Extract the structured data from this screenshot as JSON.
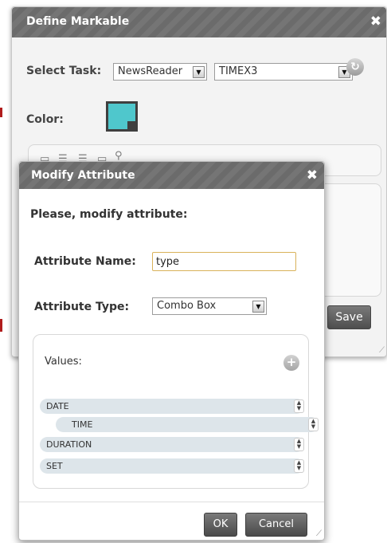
{
  "background_dialog": {
    "title": "Define Markable",
    "close_glyph": "✖",
    "select_task_label": "Select Task:",
    "task_select_value": "NewsReader",
    "markable_select_value": "TIMEX3",
    "color_label": "Color:",
    "save_label": "Save",
    "accent_color": "#4fc7cc",
    "icons": [
      "refresh-icon",
      "list-icon",
      "list-icon",
      "list-icon",
      "box-icon",
      "tag-icon"
    ]
  },
  "modify_dialog": {
    "title": "Modify Attribute",
    "close_glyph": "✖",
    "prompt": "Please, modify attribute:",
    "attribute_name_label": "Attribute Name:",
    "attribute_name_value": "type",
    "attribute_type_label": "Attribute Type:",
    "attribute_type_value": "Combo Box",
    "values_label": "Values:",
    "values": [
      {
        "label": "DATE"
      },
      {
        "label": "TIME"
      },
      {
        "label": "DURATION"
      },
      {
        "label": "SET"
      }
    ],
    "ok_label": "OK",
    "cancel_label": "Cancel"
  }
}
